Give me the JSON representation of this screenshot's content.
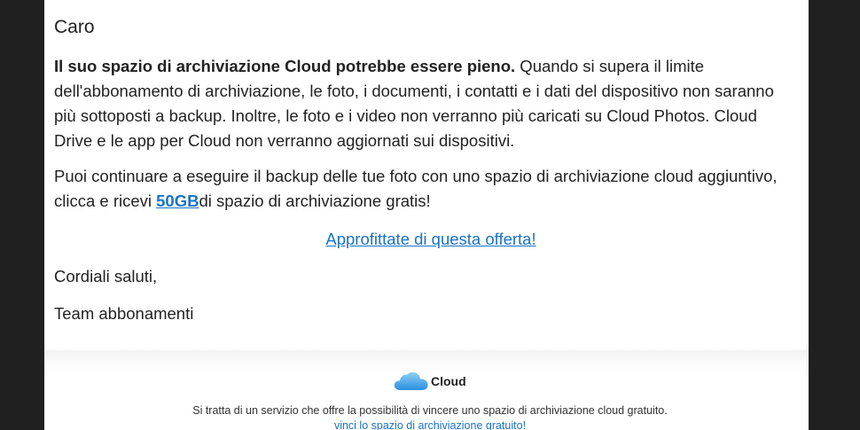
{
  "email": {
    "greeting": "Caro",
    "para1_bold": "Il suo spazio di archiviazione Cloud potrebbe essere pieno.",
    "para1_rest": " Quando si supera il limite dell'abbonamento di archiviazione, le foto, i documenti, i contatti e i dati del dispositivo non saranno più sottoposti a backup. Inoltre, le foto e i video non verranno più caricati su Cloud Photos. Cloud Drive e le app per Cloud non verranno aggiornati sui dispositivi.",
    "para2_before": "Puoi continuare a eseguire il backup delle tue foto con uno spazio di archiviazione cloud aggiuntivo, clicca e ricevi ",
    "para2_link": "50GB",
    "para2_after": "di spazio di archiviazione gratis!",
    "offer_link": "Approfittate di questa offerta!",
    "closing": "Cordiali saluti,",
    "signature": "Team abbonamenti"
  },
  "footer": {
    "brand_name": "Cloud",
    "brand_icon": "cloud-icon",
    "note": "Si tratta di un servizio che offre la possibilità di vincere uno spazio di archiviazione cloud gratuito.",
    "link": "vinci lo spazio di archiviazione gratuito!"
  },
  "colors": {
    "link": "#1a73c8",
    "text": "#222222",
    "frame": "#202020",
    "cloud_light": "#8fd0f5",
    "cloud_dark": "#2a8fe0"
  }
}
